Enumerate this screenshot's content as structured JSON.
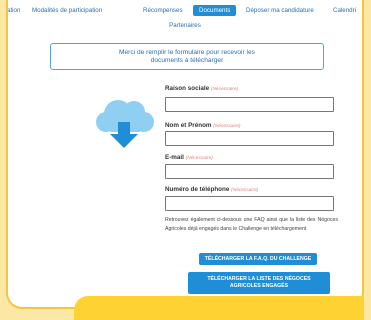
{
  "nav": {
    "items": [
      {
        "label": "ation",
        "active": false
      },
      {
        "label": "Modalités de participation",
        "active": false
      },
      {
        "label": "Récompenses",
        "active": false
      },
      {
        "label": "Documents",
        "active": true
      },
      {
        "label": "Déposer ma candidature",
        "active": false
      },
      {
        "label": "Calendri",
        "active": false
      }
    ],
    "partners": "Partenaires"
  },
  "notice": {
    "line1": "Merci de remplir le formulaire pour recevoir les",
    "line2": "documents à télécharger"
  },
  "icon": {
    "name": "cloud-download-icon",
    "color": "#8fd0f2",
    "arrow_color": "#1f8ed6"
  },
  "form": {
    "required_text": "(Nécessaire)",
    "fields": [
      {
        "label": "Raison sociale",
        "value": ""
      },
      {
        "label": "Nom et Prénom",
        "value": ""
      },
      {
        "label": "E-mail",
        "value": ""
      },
      {
        "label": "Numéro de téléphone",
        "value": ""
      }
    ]
  },
  "info_text": "Retrouvez également ci-dessous une FAQ ainsi que la liste des Négoces Agricoles déjà engagés dans le Challenge en téléchargement",
  "buttons": {
    "faq": "TÉLÉCHARGER LA F.A.Q. DU CHALLENGE",
    "list_line1": "TÉLÉCHARGER LA LISTE DES NÉGOCES",
    "list_line2": "AGRICOLES ENGAGÉS"
  },
  "colors": {
    "accent": "#1f8ed6",
    "border": "#f5c542",
    "banner": "#ffd233",
    "background": "#fde7a4"
  }
}
